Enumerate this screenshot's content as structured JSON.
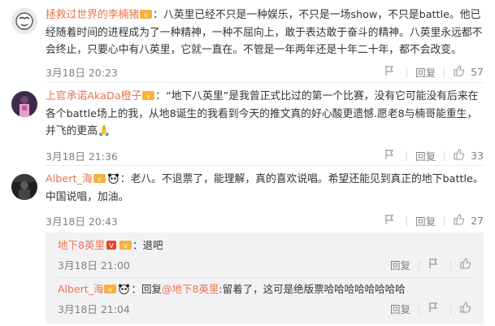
{
  "comments": [
    {
      "name": "拯救过世界的李楠猪",
      "text": "：八英里已经不只是一种娱乐，不只是一场show，不只是battle。他已经随着时间的进程成为了一种精神，一种不屈向上，敢于表达敢于奋斗的精神。八英里永远都不会终止，只要心中有八英里，它就一直在。不管是一年两年还是十年二十年，都不会改变。",
      "time": "3月18日 20:23",
      "reply_label": "回复",
      "like_count": "57"
    },
    {
      "name": "上官承诺AkaDa橙子",
      "text": "：“地下八英里”是我曾正式比过的第一个比赛，没有它可能没有后来在各个battle场上的我，从地8诞生的我看到今天的推文真的好心酸更遗憾.愿老8与楠哥能重生，并飞的更高🙏",
      "time": "3月18日 21:36",
      "reply_label": "回复",
      "like_count": "33"
    },
    {
      "name": "Albert_海",
      "text": "：老八。不退票了，能理解，真的喜欢说唱。希望还能见到真正的地下battle。中国说唱，加油。",
      "time": "3月18日 20:43",
      "reply_label": "回复",
      "like_count": "27"
    }
  ],
  "replies": [
    {
      "name": "地下8英里",
      "text": "：退吧",
      "time": "3月18日 21:00",
      "reply_label": "回复"
    },
    {
      "name": "Albert_海",
      "prefix": "：回复",
      "mention": "@地下8英里",
      "text": ":留着了，这可是绝版票哈哈哈哈哈哈哈哈",
      "time": "3月18日 21:04",
      "reply_label": "回复"
    }
  ],
  "colors": {
    "accent": "#eb7350",
    "meta": "#808080",
    "reply_bg": "#f2f2f5"
  },
  "icons": {
    "report": "report-icon",
    "like": "thumbs-up-icon",
    "vip": "vip-badge-icon",
    "panda": "panda-emoji-icon"
  }
}
